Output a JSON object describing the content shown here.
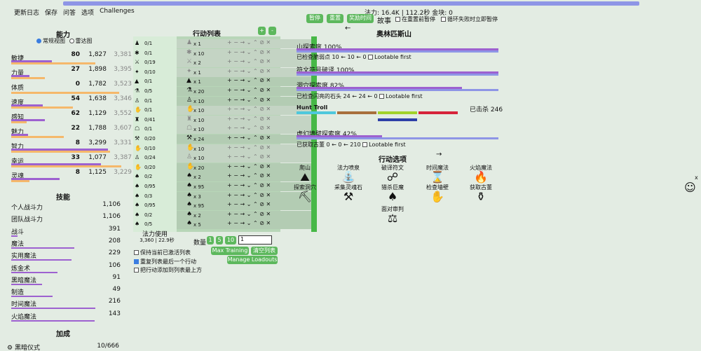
{
  "menu": [
    "更新日志",
    "保存",
    "问答",
    "选项",
    "Challenges"
  ],
  "status": {
    "mana_line": "法力: 16.4K | 112.2秒 金块: 0"
  },
  "controls": {
    "pause": "暂停",
    "restart": "重置",
    "bonus": "奖励时间",
    "story": "故事",
    "pause_on_restart": "在重置前暂停",
    "pause_on_fail": "循环失败时立即暂停"
  },
  "stats_panel": {
    "title": "能力",
    "view_normal": "常规视图",
    "view_radar": "雷达图",
    "items": [
      {
        "name": "敏捷",
        "lvl": "80",
        "talent": "1,827",
        "total": "3,381",
        "p1": 0.36,
        "p2": 0.75
      },
      {
        "name": "力量",
        "lvl": "27",
        "talent": "1,898",
        "total": "3,395",
        "p1": 0.16,
        "p2": 0.3
      },
      {
        "name": "体质",
        "lvl": "0",
        "talent": "1,782",
        "total": "3,523",
        "p1": 0.0,
        "p2": 0.96
      },
      {
        "name": "速度",
        "lvl": "54",
        "talent": "1,638",
        "total": "3,346",
        "p1": 0.28,
        "p2": 0.55
      },
      {
        "name": "感知",
        "lvl": "62",
        "talent": "1,129",
        "total": "3,552",
        "p1": 0.3,
        "p2": 0.14
      },
      {
        "name": "魅力",
        "lvl": "22",
        "talent": "1,788",
        "total": "3,607",
        "p1": 0.15,
        "p2": 0.47
      },
      {
        "name": "智力",
        "lvl": "8",
        "talent": "3,299",
        "total": "3,331",
        "p1": 0.86,
        "p2": 0.88
      },
      {
        "name": "幸运",
        "lvl": "33",
        "talent": "1,077",
        "total": "3,387",
        "p1": 0.8,
        "p2": 0.98
      },
      {
        "name": "灵魂",
        "lvl": "8",
        "talent": "1,125",
        "total": "3,229",
        "p1": 0.43,
        "p2": 0.16
      }
    ]
  },
  "skills_panel": {
    "title": "技能",
    "items": [
      {
        "name": "个人战斗力",
        "value": "1,106",
        "p": 0
      },
      {
        "name": "团队战斗力",
        "value": "1,106",
        "p": 0
      },
      {
        "name": "战斗",
        "value": "391",
        "p": 0.06
      },
      {
        "name": "魔法",
        "value": "208",
        "p": 0.58
      },
      {
        "name": "实用魔法",
        "value": "229",
        "p": 0.55
      },
      {
        "name": "炼金术",
        "value": "106",
        "p": 0.42
      },
      {
        "name": "黑暗魔法",
        "value": "91",
        "p": 0.28
      },
      {
        "name": "制造",
        "value": "49",
        "p": 0.38
      },
      {
        "name": "时间魔法",
        "value": "216",
        "p": 0.77
      },
      {
        "name": "火焰魔法",
        "value": "143",
        "p": 0.76
      }
    ]
  },
  "buffs_panel": {
    "title": "加成",
    "items": [
      {
        "name": "黑暗仪式",
        "value": "10/666"
      }
    ]
  },
  "action_list": {
    "title": "行动列表",
    "rows": [
      {
        "progress": "0/1",
        "count": "x 1",
        "icon": "♟",
        "grey": true
      },
      {
        "progress": "0/1",
        "count": "x 10",
        "icon": "✱",
        "grey": true
      },
      {
        "progress": "0/19",
        "count": "x 2",
        "icon": "⚔",
        "grey": true
      },
      {
        "progress": "0/10",
        "count": "x 1",
        "icon": "✦",
        "grey": true
      },
      {
        "progress": "0/1",
        "count": "x 1",
        "icon": "▲",
        "grey": false
      },
      {
        "progress": "0/5",
        "count": "x 20",
        "icon": "⚗",
        "grey": false
      },
      {
        "progress": "0/1",
        "count": "x 10",
        "icon": "♙",
        "grey": false
      },
      {
        "progress": "0/1",
        "count": "x 10",
        "icon": "✋",
        "grey": true
      },
      {
        "progress": "0/41",
        "count": "x 10",
        "icon": "♜",
        "grey": true
      },
      {
        "progress": "0/1",
        "count": "x 10",
        "icon": "☖",
        "grey": true
      },
      {
        "progress": "0/20",
        "count": "x 24",
        "icon": "⚒",
        "grey": false
      },
      {
        "progress": "0/10",
        "count": "x 10",
        "icon": "✋",
        "grey": true
      },
      {
        "progress": "0/24",
        "count": "x 10",
        "icon": "♙",
        "grey": true
      },
      {
        "progress": "0/20",
        "count": "x 20",
        "icon": "✋",
        "grey": false
      },
      {
        "progress": "0/2",
        "count": "x 2",
        "icon": "♠",
        "grey": false
      },
      {
        "progress": "0/95",
        "count": "x 95",
        "icon": "♠",
        "grey": false
      },
      {
        "progress": "0/3",
        "count": "x 3",
        "icon": "♠",
        "grey": false
      },
      {
        "progress": "0/95",
        "count": "x 95",
        "icon": "♠",
        "grey": false
      },
      {
        "progress": "0/2",
        "count": "x 2",
        "icon": "♠",
        "grey": false
      },
      {
        "progress": "0/5",
        "count": "x 5",
        "icon": "♠",
        "grey": false
      }
    ],
    "mana_used": "法力使用",
    "mana_value": "3,360 | 22.9秒",
    "qty_label": "数量",
    "qty": [
      "1",
      "5",
      "10"
    ],
    "qty_input": "1",
    "keep_active": "保持当前已激活列表",
    "repeat_last": "重复列表最后一个行动",
    "add_to_top": "把行动添加到列表最上方",
    "max_training": "Max Training",
    "clear_list": "清空列表",
    "manage_loadouts": "Manage Loadouts"
  },
  "town": {
    "name": "奥林匹斯山",
    "progress": [
      {
        "label": "山探索度 100%",
        "p": 1.0,
        "p2": 1.0
      },
      {
        "label": "符文符号破译 100%",
        "p": 1.0,
        "p2": 1.0
      },
      {
        "label": "洞穴探索度 82%",
        "p": 0.82,
        "p2": 1.0
      },
      {
        "label": "虚幻墙壁探索度 42%",
        "p": 0.42,
        "p2": 1.0
      }
    ],
    "check1": "已检查脆弱点 10 ← 10 ← 0",
    "check2": "已检查闪亮的石头 24 ← 24 ← 0",
    "check3": "已获取古董 0 ← 0 ← 210",
    "lootable": "Lootable first",
    "hunt": "Hunt Troll",
    "hunt_kills": "已击杀 246",
    "options_title": "行动选项",
    "options": [
      {
        "label": "爬山",
        "icon": "⛰"
      },
      {
        "label": "法力喷泉",
        "icon": "⛲"
      },
      {
        "label": "破译符文",
        "icon": "☍"
      },
      {
        "label": "时间魔法",
        "icon": "⌛"
      },
      {
        "label": "火焰魔法",
        "icon": "🔥"
      },
      {
        "label": "探索洞穴",
        "icon": "⛏"
      },
      {
        "label": "采集灵魂石",
        "icon": "⚒"
      },
      {
        "label": "猎杀巨魔",
        "icon": "♠"
      },
      {
        "label": "检查墙壁",
        "icon": "✋"
      },
      {
        "label": "获取古董",
        "icon": "⚱"
      },
      {
        "label": "面对审判",
        "icon": "⚖"
      }
    ]
  },
  "colors": {
    "accent": "#5db85d",
    "stat_bar": "#9d61d0",
    "talent_bar": "#f5b86b",
    "topbar": "#8e95e6"
  }
}
